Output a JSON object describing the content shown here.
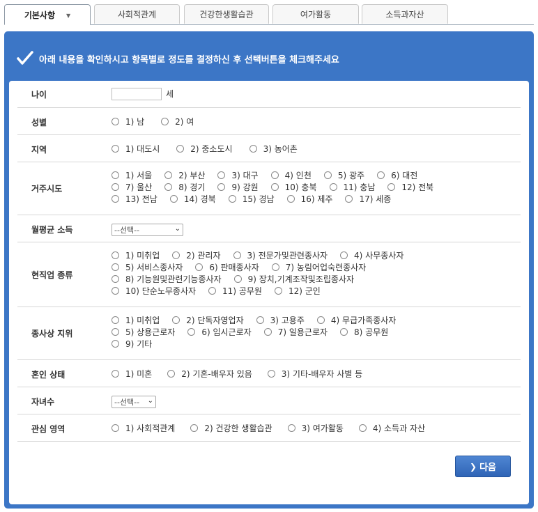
{
  "tabs": [
    {
      "label": "기본사항",
      "active": true
    },
    {
      "label": "사회적관계"
    },
    {
      "label": "건강한생활습관"
    },
    {
      "label": "여가활동"
    },
    {
      "label": "소득과자산"
    }
  ],
  "banner": {
    "text": "아래 내용을 확인하시고 항목별로 정도를 결정하신 후 선택버튼을 체크해주세요"
  },
  "form": {
    "age": {
      "label": "나이",
      "unit": "세",
      "value": ""
    },
    "gender": {
      "label": "성별",
      "options": [
        "1) 남",
        "2) 여"
      ]
    },
    "region": {
      "label": "지역",
      "options": [
        "1) 대도시",
        "2) 중소도시",
        "3) 농어촌"
      ]
    },
    "province": {
      "label": "거주시도",
      "options": [
        "1) 서울",
        "2) 부산",
        "3) 대구",
        "4) 인천",
        "5) 광주",
        "6) 대전",
        "7) 울산",
        "8) 경기",
        "9) 강원",
        "10) 충북",
        "11) 충남",
        "12) 전북",
        "13) 전남",
        "14) 경북",
        "15) 경남",
        "16) 제주",
        "17) 세종"
      ]
    },
    "income": {
      "label": "월평균 소득",
      "selected": "--선택--"
    },
    "occupation": {
      "label": "현직업 종류",
      "options": [
        "1) 미취업",
        "2) 관리자",
        "3) 전문가및관련종사자",
        "4) 사무종사자",
        "5) 서비스종사자",
        "6) 판매종사자",
        "7) 농림어업숙련종사자",
        "8) 기능원및관련기능종사자",
        "9) 장치,기계조작및조립종사자",
        "10) 단순노무종사자",
        "11) 공무원",
        "12) 군인"
      ]
    },
    "employment": {
      "label": "종사상 지위",
      "options": [
        "1) 미취업",
        "2) 단독자영업자",
        "3) 고용주",
        "4) 무급가족종사자",
        "5) 상용근로자",
        "6) 임시근로자",
        "7) 일용근로자",
        "8) 공무원",
        "9) 기타"
      ]
    },
    "marital": {
      "label": "혼인 상태",
      "options": [
        "1) 미혼",
        "2) 기혼-배우자 있음",
        "3) 기타-배우자 사별 등"
      ]
    },
    "children": {
      "label": "자녀수",
      "selected": "--선택--"
    },
    "interest": {
      "label": "관심 영역",
      "options": [
        "1) 사회적관계",
        "2) 건강한 생활습관",
        "3) 여가활동",
        "4) 소득과 자산"
      ]
    }
  },
  "next_button": {
    "label": "다음"
  }
}
